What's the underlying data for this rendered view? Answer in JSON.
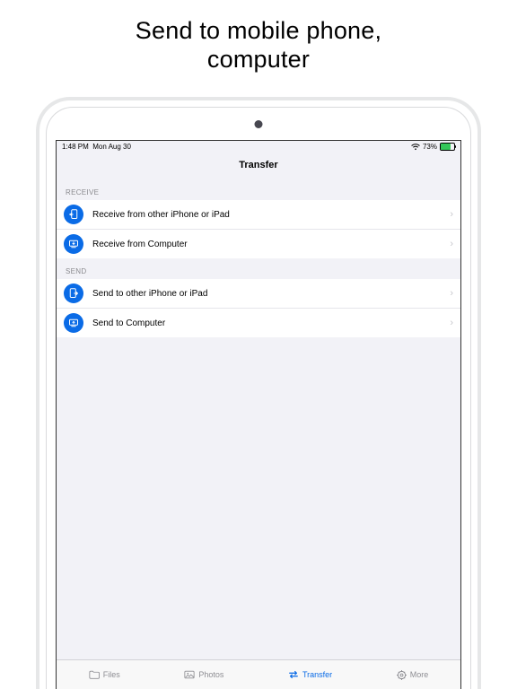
{
  "promo": {
    "line1": "Send to mobile phone,",
    "line2": "computer"
  },
  "statusbar": {
    "time": "1:48 PM",
    "date": "Mon Aug 30",
    "battery": "73%"
  },
  "header": {
    "title": "Transfer"
  },
  "sections": {
    "receive": {
      "header": "RECEIVE",
      "items": [
        {
          "label": "Receive from other iPhone or iPad",
          "icon": "device-receive-icon"
        },
        {
          "label": "Receive from Computer",
          "icon": "computer-receive-icon"
        }
      ]
    },
    "send": {
      "header": "SEND",
      "items": [
        {
          "label": "Send to other iPhone or iPad",
          "icon": "device-send-icon"
        },
        {
          "label": "Send to Computer",
          "icon": "computer-send-icon"
        }
      ]
    }
  },
  "tabbar": {
    "items": [
      {
        "label": "Files",
        "icon": "folder-icon",
        "selected": false
      },
      {
        "label": "Photos",
        "icon": "photos-icon",
        "selected": false
      },
      {
        "label": "Transfer",
        "icon": "transfer-icon",
        "selected": true
      },
      {
        "label": "More",
        "icon": "gear-icon",
        "selected": false
      }
    ]
  },
  "colors": {
    "accent": "#0A6BE6",
    "bg": "#F2F2F7"
  }
}
